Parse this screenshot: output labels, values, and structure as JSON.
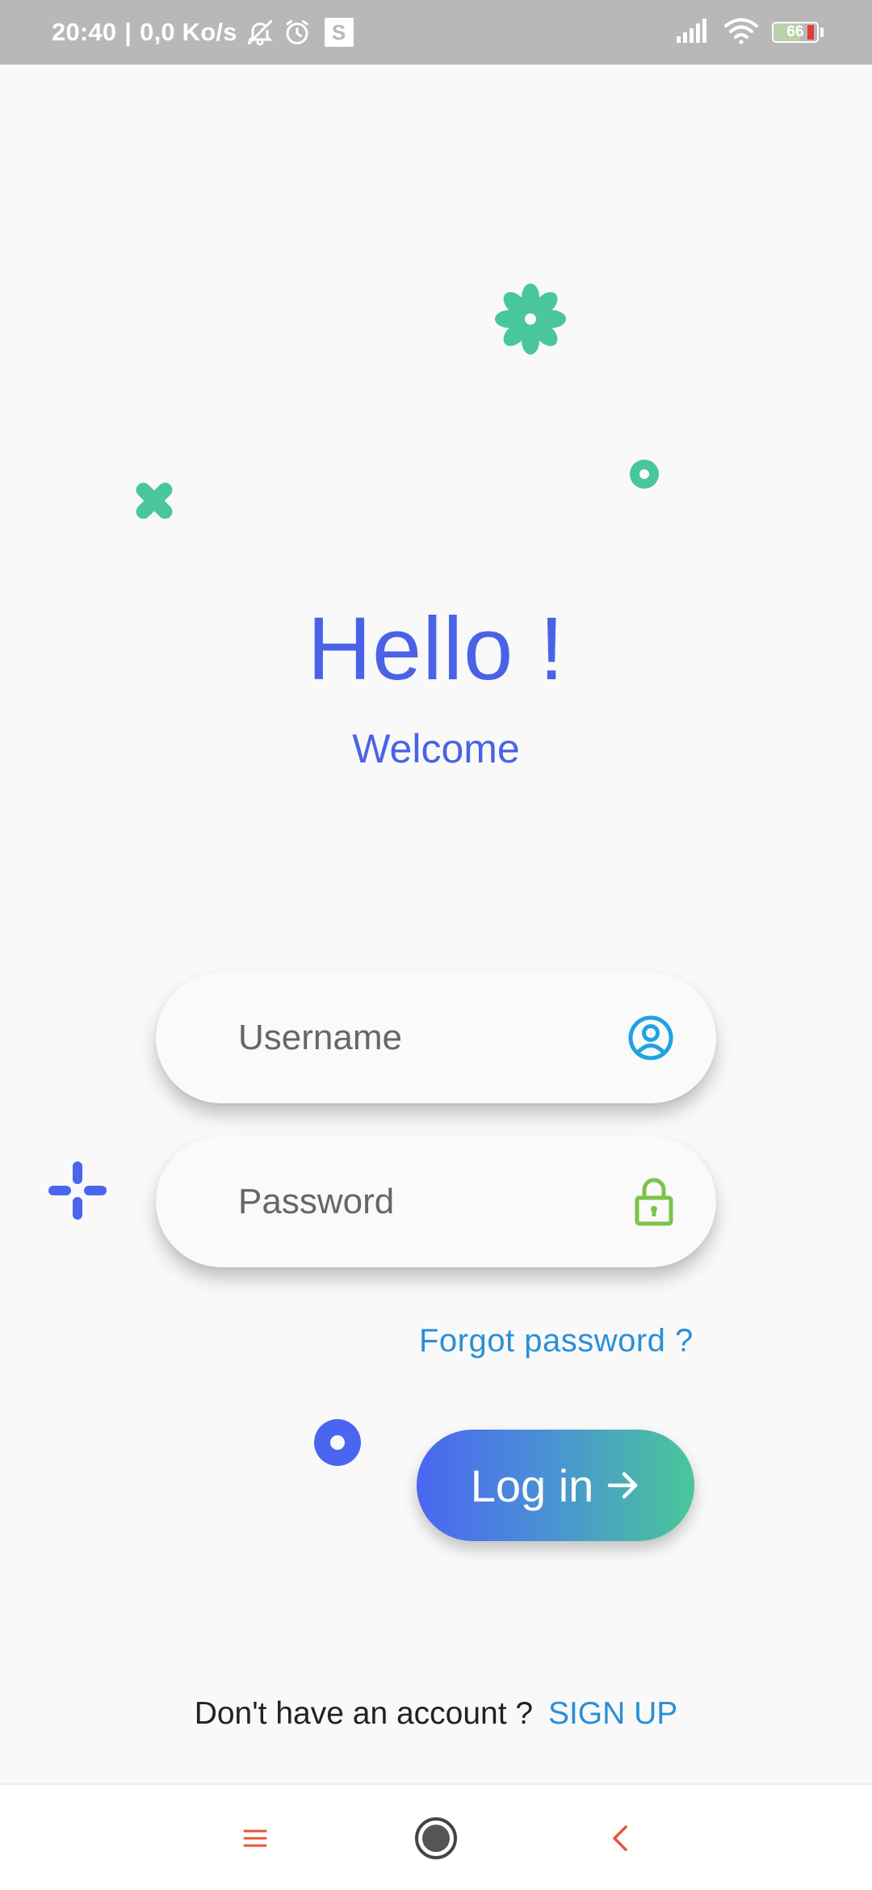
{
  "status_bar": {
    "time": "20:40",
    "separator": "|",
    "speed": "0,0 Ko/s",
    "badge": "S",
    "battery": "66"
  },
  "greeting": {
    "title": "Hello !",
    "subtitle": "Welcome"
  },
  "login_form": {
    "username_placeholder": "Username",
    "password_placeholder": "Password",
    "forgot_label": "Forgot password ?",
    "login_label": "Log in"
  },
  "signup": {
    "prompt": "Don't have an account ?",
    "link_label": "SIGN UP"
  },
  "colors": {
    "accent_blue": "#4a63e6",
    "accent_green": "#49c79a",
    "link_blue": "#2a8fd8",
    "lock_green": "#7cc24b",
    "user_icon_blue": "#1ea3e0"
  }
}
